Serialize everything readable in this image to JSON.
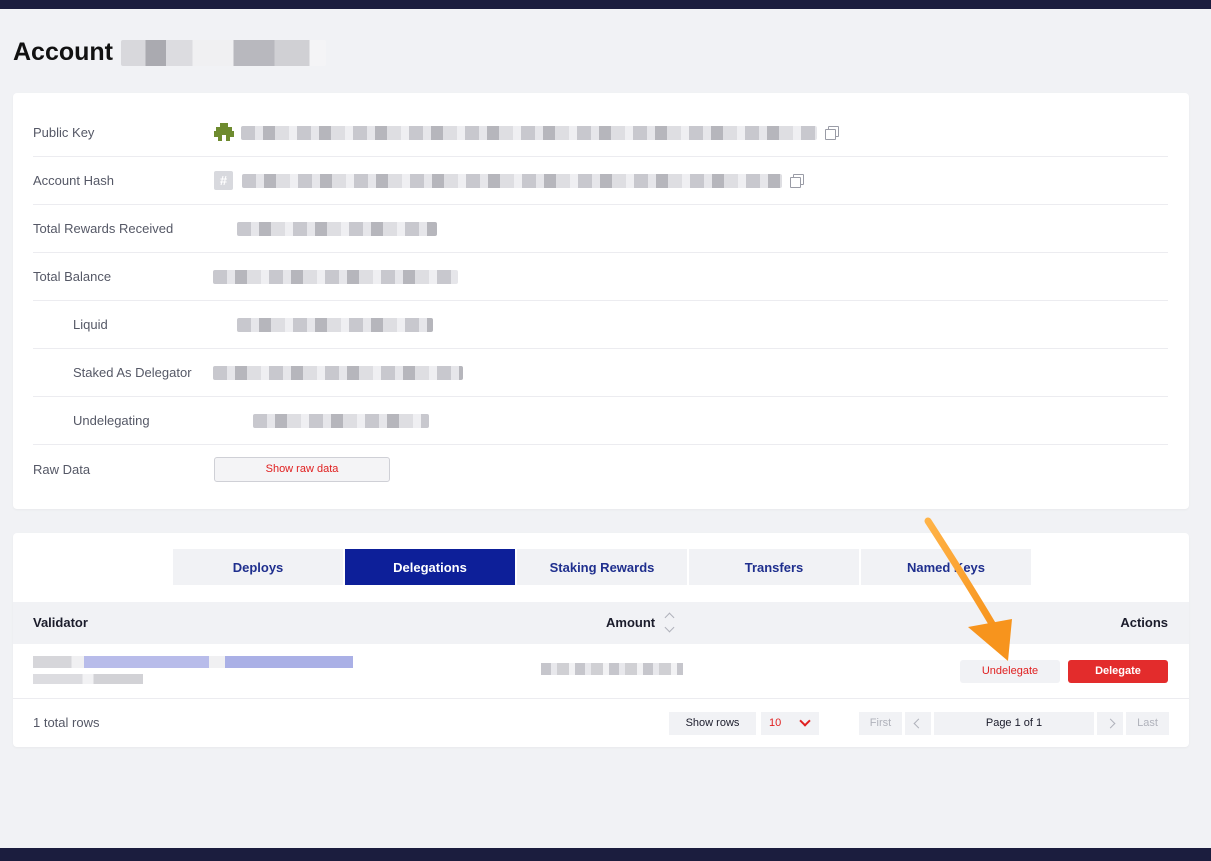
{
  "page": {
    "title": "Account"
  },
  "info": {
    "public_key_label": "Public Key",
    "account_hash_label": "Account Hash",
    "total_rewards_label": "Total Rewards Received",
    "total_balance_label": "Total Balance",
    "liquid_label": "Liquid",
    "staked_label": "Staked As Delegator",
    "undelegating_label": "Undelegating",
    "raw_data_label": "Raw Data",
    "raw_data_button": "Show raw data",
    "hash_icon_glyph": "#"
  },
  "tabs": [
    {
      "label": "Deploys"
    },
    {
      "label": "Delegations"
    },
    {
      "label": "Staking Rewards"
    },
    {
      "label": "Transfers"
    },
    {
      "label": "Named Keys"
    }
  ],
  "table": {
    "headers": {
      "validator": "Validator",
      "amount": "Amount",
      "actions": "Actions"
    },
    "row": {
      "undelegate": "Undelegate",
      "delegate": "Delegate"
    },
    "footer": {
      "total_rows": "1 total rows",
      "show_rows": "Show rows",
      "rows_value": "10",
      "first": "First",
      "page": "Page 1 of 1",
      "last": "Last"
    }
  },
  "colors": {
    "brand": "#0d1f99",
    "danger": "#e32c2c",
    "annotation_arrow": "#f7941d"
  }
}
